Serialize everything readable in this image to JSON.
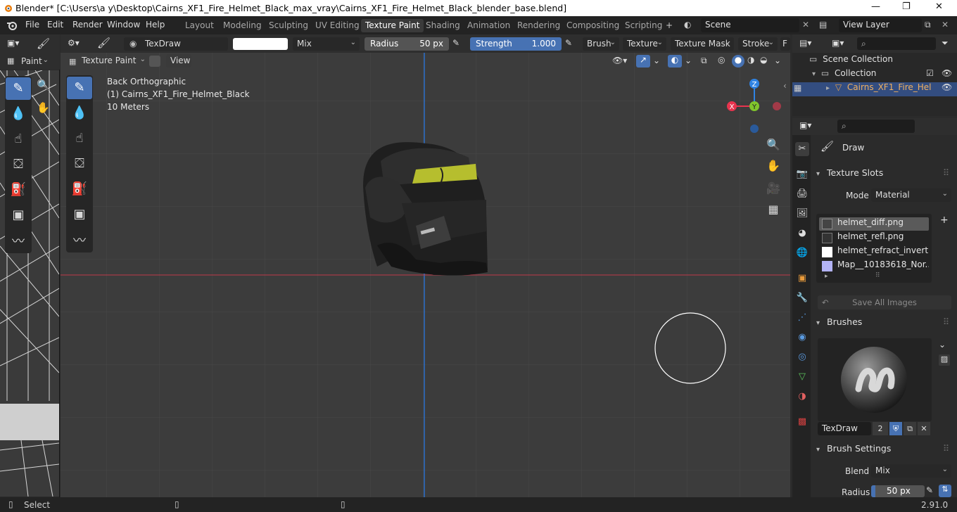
{
  "window": {
    "title": "Blender* [C:\\Users\\a y\\Desktop\\Cairns_XF1_Fire_Helmet_Black_max_vray\\Cairns_XF1_Fire_Helmet_Black_blender_base.blend]",
    "minimize": "—",
    "maximize": "❐",
    "close": "✕"
  },
  "menu": [
    "File",
    "Edit",
    "Render",
    "Window",
    "Help"
  ],
  "workspaces": [
    "Layout",
    "Modeling",
    "Sculpting",
    "UV Editing",
    "Texture Paint",
    "Shading",
    "Animation",
    "Rendering",
    "Compositing",
    "Scripting"
  ],
  "active_workspace": "Texture Paint",
  "add_workspace": "+",
  "scene": {
    "name": "Scene",
    "view_layer": "View Layer"
  },
  "left_header": {
    "mode": "Paint"
  },
  "tool_header": {
    "brush_name": "TexDraw",
    "blend": "Mix",
    "radius_label": "Radius",
    "radius_value": "50 px",
    "strength_label": "Strength",
    "strength_value": "1.000",
    "menus": [
      "Brush",
      "Texture",
      "Texture Mask",
      "Stroke",
      "F"
    ]
  },
  "viewport_header": {
    "mode": "Texture Paint",
    "view": "View"
  },
  "overlay_text": {
    "view_name": "Back Orthographic",
    "object_name": "(1) Cairns_XF1_Fire_Helmet_Black",
    "scale": "10 Meters"
  },
  "gizmo": {
    "z": "Z",
    "x": "X",
    "y": "Y"
  },
  "outliner": {
    "scene_collection": "Scene Collection",
    "collection": "Collection",
    "object": "Cairns_XF1_Fire_Hel"
  },
  "properties": {
    "active_tool": "Draw",
    "texture_slots": {
      "title": "Texture Slots",
      "mode_label": "Mode",
      "mode_value": "Material",
      "slots": [
        "helmet_diff.png",
        "helmet_refl.png",
        "helmet_refract_invert.p...",
        "Map__10183618_Nor..."
      ],
      "save_all": "Save All Images"
    },
    "brushes": {
      "title": "Brushes",
      "brush_name": "TexDraw",
      "users": "2"
    },
    "brush_settings": {
      "title": "Brush Settings",
      "blend_label": "Blend",
      "blend_value": "Mix",
      "radius_label": "Radius",
      "radius_value": "50 px"
    }
  },
  "statusbar": {
    "action": "Select",
    "version": "2.91.0"
  },
  "colors": {
    "accent": "#4772b3",
    "helmet_stripe": "#b6be2e",
    "axis_x": "#e8344e",
    "axis_y": "#80c52c",
    "axis_z": "#2f83e3"
  }
}
